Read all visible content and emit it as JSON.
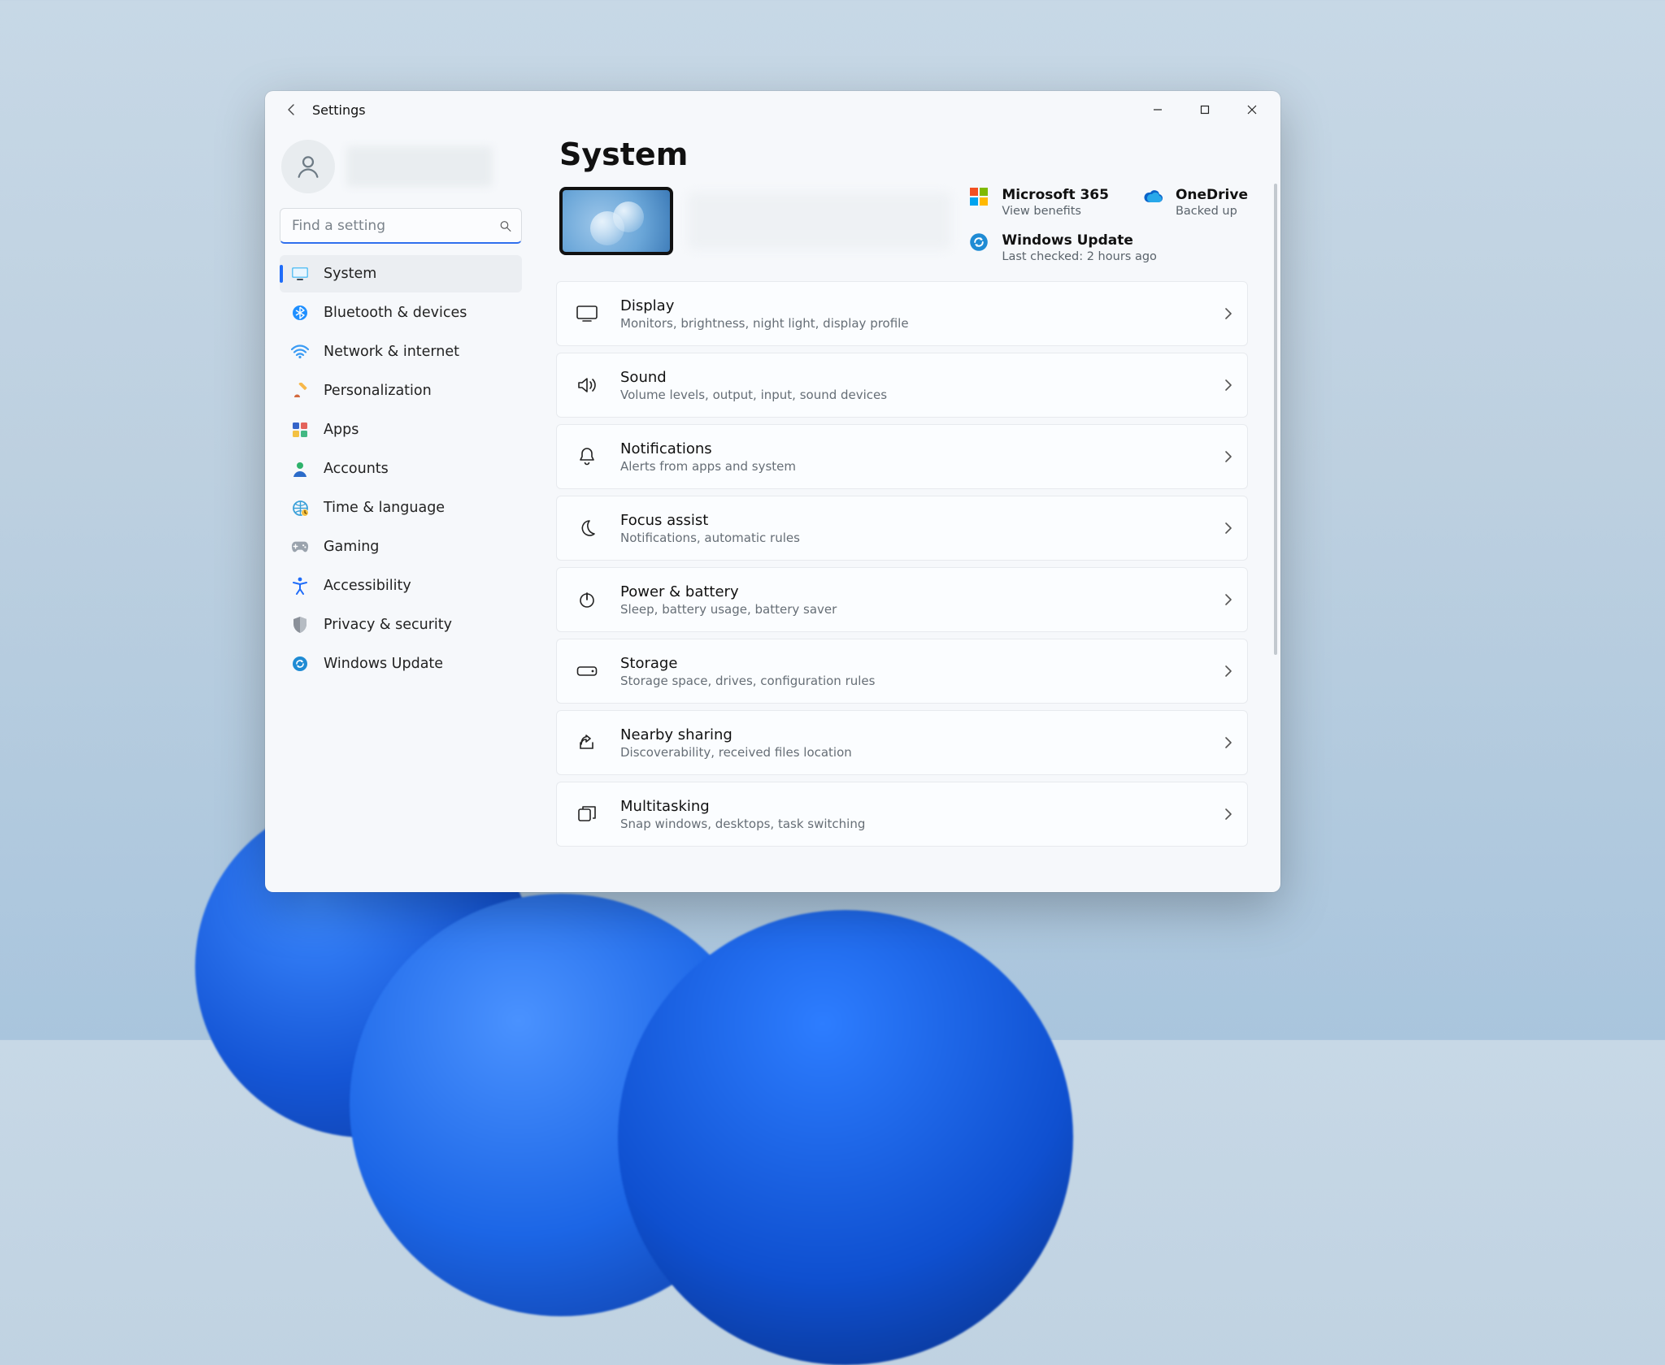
{
  "window": {
    "title": "Settings"
  },
  "search": {
    "placeholder": "Find a setting"
  },
  "nav": {
    "items": [
      {
        "label": "System"
      },
      {
        "label": "Bluetooth & devices"
      },
      {
        "label": "Network & internet"
      },
      {
        "label": "Personalization"
      },
      {
        "label": "Apps"
      },
      {
        "label": "Accounts"
      },
      {
        "label": "Time & language"
      },
      {
        "label": "Gaming"
      },
      {
        "label": "Accessibility"
      },
      {
        "label": "Privacy & security"
      },
      {
        "label": "Windows Update"
      }
    ],
    "active_index": 0
  },
  "page": {
    "title": "System"
  },
  "promos": {
    "m365": {
      "title": "Microsoft 365",
      "sub": "View benefits"
    },
    "onedrive": {
      "title": "OneDrive",
      "sub": "Backed up"
    },
    "update": {
      "title": "Windows Update",
      "sub": "Last checked: 2 hours ago"
    }
  },
  "settings": [
    {
      "title": "Display",
      "sub": "Monitors, brightness, night light, display profile"
    },
    {
      "title": "Sound",
      "sub": "Volume levels, output, input, sound devices"
    },
    {
      "title": "Notifications",
      "sub": "Alerts from apps and system"
    },
    {
      "title": "Focus assist",
      "sub": "Notifications, automatic rules"
    },
    {
      "title": "Power & battery",
      "sub": "Sleep, battery usage, battery saver"
    },
    {
      "title": "Storage",
      "sub": "Storage space, drives, configuration rules"
    },
    {
      "title": "Nearby sharing",
      "sub": "Discoverability, received files location"
    },
    {
      "title": "Multitasking",
      "sub": "Snap windows, desktops, task switching"
    }
  ]
}
